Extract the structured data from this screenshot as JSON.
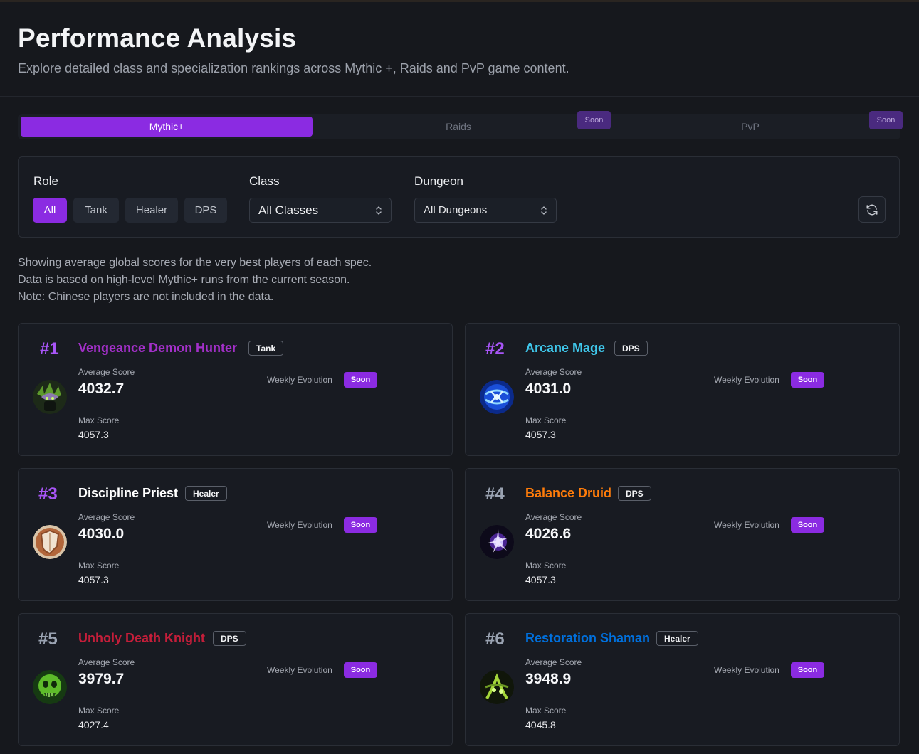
{
  "header": {
    "title": "Performance Analysis",
    "subtitle": "Explore detailed class and specialization rankings across Mythic +, Raids and PvP game content."
  },
  "tabs": [
    {
      "label": "Mythic+",
      "active": true
    },
    {
      "label": "Raids",
      "badge": "Soon"
    },
    {
      "label": "PvP",
      "badge": "Soon"
    }
  ],
  "filters": {
    "role_label": "Role",
    "roles": [
      "All",
      "Tank",
      "Healer",
      "DPS"
    ],
    "selected_role": "All",
    "class_label": "Class",
    "class_value": "All Classes",
    "dungeon_label": "Dungeon",
    "dungeon_value": "All Dungeons"
  },
  "info_lines": [
    "Showing average global scores for the very best players of each spec.",
    "Data is based on high-level Mythic+ runs from the current season.",
    "Note: Chinese players are not included in the data."
  ],
  "labels": {
    "average_score": "Average Score",
    "max_score": "Max Score",
    "weekly_evolution": "Weekly Evolution",
    "soon": "Soon"
  },
  "colors": {
    "accent": "#8b2be2",
    "rank_purple": "#a855f7",
    "rank_gray": "#9aa3b2"
  },
  "cards": [
    {
      "rank": "#1",
      "spec": "Vengeance Demon Hunter",
      "role": "Tank",
      "avg": "4032.7",
      "max": "4057.3",
      "color": "#a330c9",
      "icon": "demon-hunter-icon"
    },
    {
      "rank": "#2",
      "spec": "Arcane Mage",
      "role": "DPS",
      "avg": "4031.0",
      "max": "4057.3",
      "color": "#3fc7eb",
      "icon": "arcane-mage-icon"
    },
    {
      "rank": "#3",
      "spec": "Discipline Priest",
      "role": "Healer",
      "avg": "4030.0",
      "max": "4057.3",
      "color": "#ffffff",
      "icon": "discipline-priest-icon"
    },
    {
      "rank": "#4",
      "spec": "Balance Druid",
      "role": "DPS",
      "avg": "4026.6",
      "max": "4057.3",
      "color": "#ff7c0a",
      "icon": "balance-druid-icon"
    },
    {
      "rank": "#5",
      "spec": "Unholy Death Knight",
      "role": "DPS",
      "avg": "3979.7",
      "max": "4027.4",
      "color": "#c41e3a",
      "icon": "unholy-death-knight-icon"
    },
    {
      "rank": "#6",
      "spec": "Restoration Shaman",
      "role": "Healer",
      "avg": "3948.9",
      "max": "4045.8",
      "color": "#0070dd",
      "icon": "restoration-shaman-icon"
    }
  ]
}
